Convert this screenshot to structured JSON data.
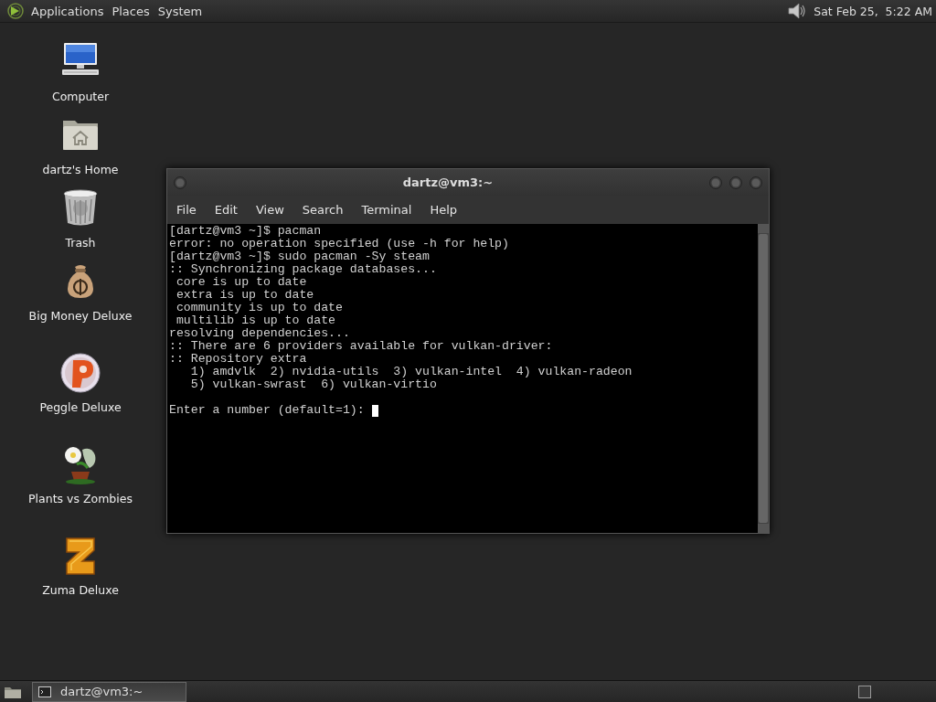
{
  "top_panel": {
    "menus": [
      "Applications",
      "Places",
      "System"
    ],
    "clock": "Sat Feb 25,  5:22 AM"
  },
  "desktop_icons": [
    {
      "kind": "computer",
      "label": "Computer"
    },
    {
      "kind": "home",
      "label": "dartz's Home"
    },
    {
      "kind": "trash",
      "label": "Trash"
    },
    {
      "kind": "money",
      "label": "Big Money Deluxe"
    },
    {
      "kind": "peggle",
      "label": "Peggle Deluxe"
    },
    {
      "kind": "plants",
      "label": "Plants vs Zombies"
    },
    {
      "kind": "zuma",
      "label": "Zuma Deluxe"
    }
  ],
  "window": {
    "title": "dartz@vm3:~",
    "menu": [
      "File",
      "Edit",
      "View",
      "Search",
      "Terminal",
      "Help"
    ],
    "terminal": {
      "lines": [
        "[dartz@vm3 ~]$ pacman",
        "error: no operation specified (use -h for help)",
        "[dartz@vm3 ~]$ sudo pacman -Sy steam",
        ":: Synchronizing package databases...",
        " core is up to date",
        " extra is up to date",
        " community is up to date",
        " multilib is up to date",
        "resolving dependencies...",
        ":: There are 6 providers available for vulkan-driver:",
        ":: Repository extra",
        "   1) amdvlk  2) nvidia-utils  3) vulkan-intel  4) vulkan-radeon",
        "   5) vulkan-swrast  6) vulkan-virtio"
      ],
      "prompt": "Enter a number (default=1): "
    }
  },
  "taskbar": {
    "tasks": [
      {
        "label": "dartz@vm3:~",
        "selected": true
      }
    ]
  }
}
